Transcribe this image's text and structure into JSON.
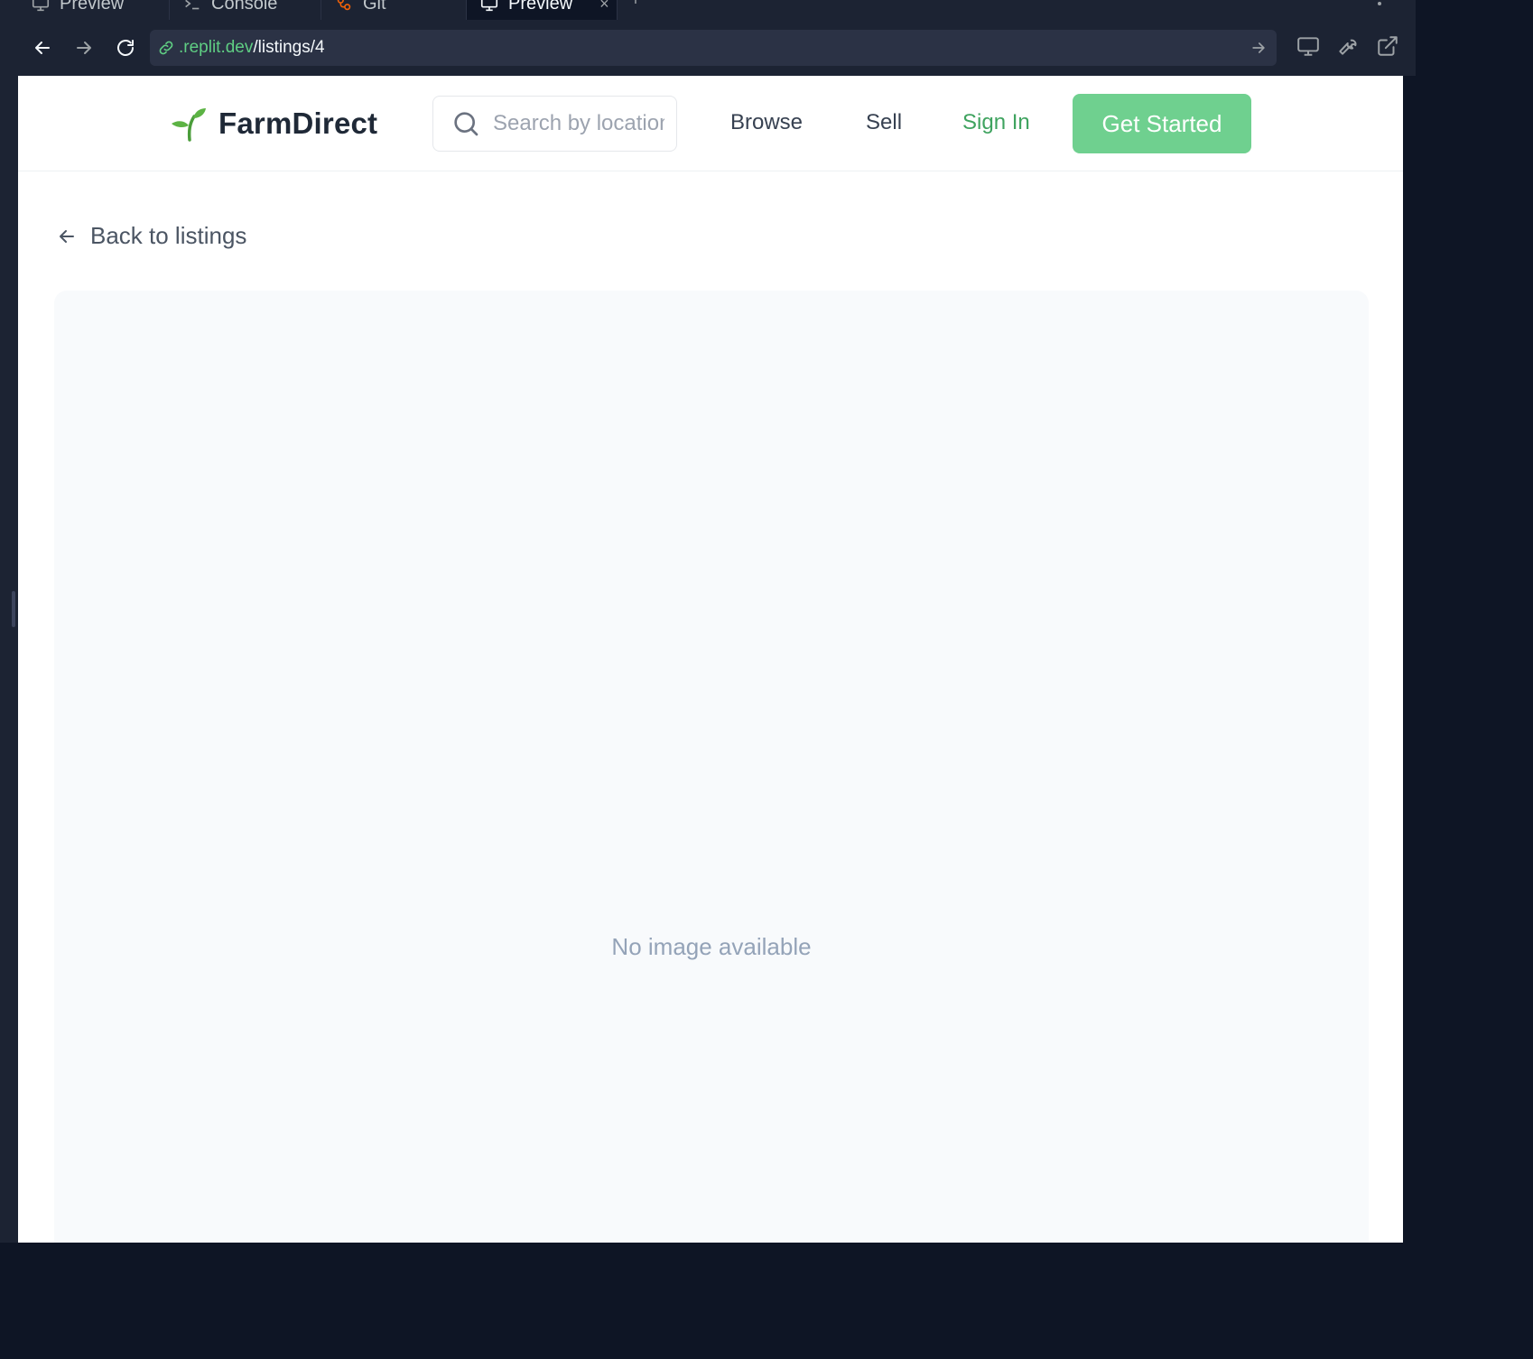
{
  "editor": {
    "tabs": [
      {
        "label": "Preview",
        "icon": "monitor-icon",
        "active": false
      },
      {
        "label": "Console",
        "icon": "terminal-icon",
        "active": false
      },
      {
        "label": "Git",
        "icon": "git-icon",
        "active": false
      },
      {
        "label": "Preview",
        "icon": "monitor-icon",
        "active": true
      }
    ],
    "new_tab_label": "+",
    "close_glyph": "×"
  },
  "browser": {
    "url_host": ".replit.dev",
    "url_path": "/listings/4",
    "tool_icons": [
      "device-icon",
      "wrench-icon",
      "external-link-icon"
    ]
  },
  "site": {
    "brand": "FarmDirect",
    "search_placeholder": "Search by location",
    "nav": {
      "browse": "Browse",
      "sell": "Sell",
      "sign_in": "Sign In"
    },
    "cta": "Get Started",
    "back_link": "Back to listings",
    "no_image": "No image available",
    "colors": {
      "brand_green": "#3fa35f",
      "cta_green": "#6fd08f",
      "text_dark": "#1f2937"
    }
  }
}
